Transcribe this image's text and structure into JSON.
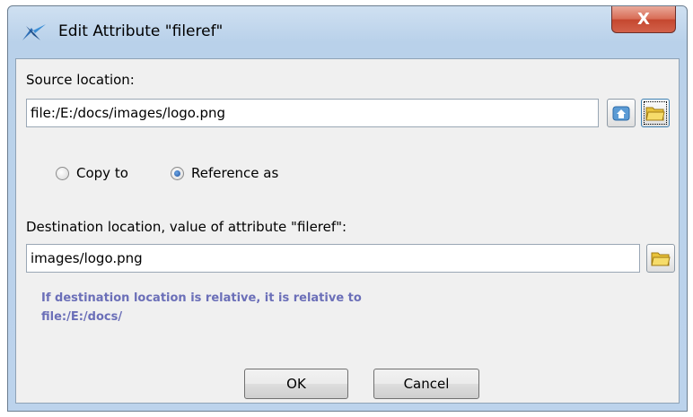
{
  "window": {
    "title": "Edit Attribute \"fileref\"",
    "close_glyph": "X",
    "app_icon": "xmlmind-icon"
  },
  "source": {
    "label": "Source location:",
    "value": "file:/E:/docs/images/logo.png",
    "home_icon": "home-folder-icon",
    "browse_icon": "open-folder-icon"
  },
  "mode": {
    "options": [
      {
        "label": "Copy to",
        "checked": false
      },
      {
        "label": "Reference as",
        "checked": true
      }
    ]
  },
  "destination": {
    "label": "Destination location, value of attribute \"fileref\":",
    "value": "images/logo.png",
    "browse_icon": "open-folder-icon",
    "hint_line1": "If destination location is relative, it is relative to",
    "hint_line2": "file:/E:/docs/"
  },
  "buttons": {
    "ok": "OK",
    "cancel": "Cancel"
  },
  "colors": {
    "hint_text": "#6b6fb8",
    "title_bar": "#bcd3ec",
    "close_button": "#c4472f"
  }
}
